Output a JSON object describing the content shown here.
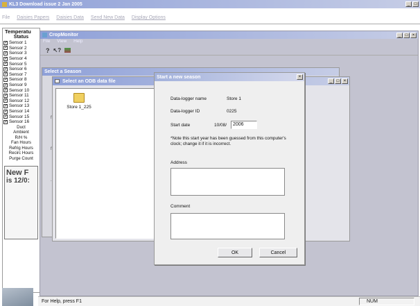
{
  "main_window": {
    "title": "KL3 Download issue 2 Jan 2005",
    "menu": [
      "File",
      "Daisies Papers",
      "Daisies Data",
      "Send New Data",
      "Display Options"
    ],
    "status_left": "For Help, press F1",
    "status_right": "NUM"
  },
  "left_panel": {
    "header_line1": "Temperatu",
    "header_line2": "Status",
    "sensors": [
      "Sensor 1",
      "Sensor 2",
      "Sensor 3",
      "Sensor 4",
      "Sensor 5",
      "Sensor 6",
      "Sensor 7",
      "Sensor 8",
      "Sensor 9",
      "Sensor 10",
      "Sensor 11",
      "Sensor 12",
      "Sensor 13",
      "Sensor 14",
      "Sensor 15",
      "Sensor 16"
    ],
    "labels": [
      "Duct",
      "Ambient",
      "R/H %",
      "Fan Hours",
      "Refrig Hours",
      "Recirc Hours",
      "Purge Count"
    ],
    "news_line1": "New F",
    "news_line2": "is 12/0:"
  },
  "crop_monitor": {
    "title": "CropMonitor",
    "menu": [
      "File",
      "View",
      "Help"
    ]
  },
  "select_season": {
    "title": "Select a Season"
  },
  "select_odb": {
    "title": "Select an ODB data file",
    "folder_label": "Store 1_225"
  },
  "dialog": {
    "title": "Start a new season",
    "logger_name_label": "Data-logger name",
    "logger_name_value": "Store 1",
    "logger_id_label": "Data-logger ID",
    "logger_id_value": "0225",
    "start_date_label": "Start date",
    "start_date_prefix": "10/08/",
    "start_date_year": "2006",
    "note": "*Note this start year has been guessed from this computer's clock; change it if it is incorrect.",
    "address_label": "Address",
    "comment_label": "Comment",
    "ok_label": "OK",
    "cancel_label": "Cancel"
  }
}
